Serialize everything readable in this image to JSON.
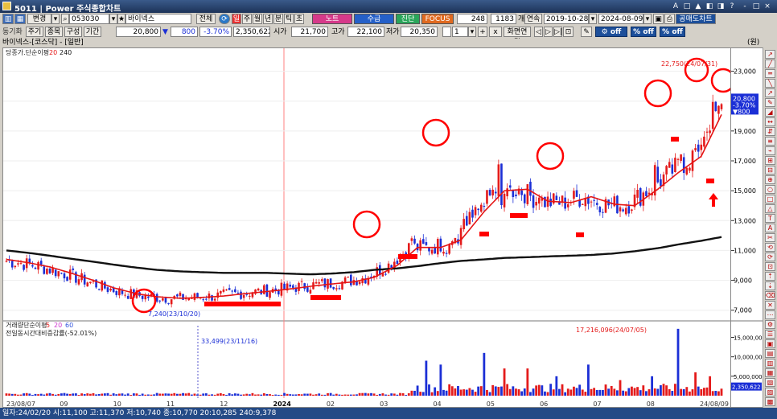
{
  "window": {
    "title": "5011 | Power 주식종합차트",
    "controls": [
      "A",
      "□",
      "▲",
      "◧",
      "◨",
      "?",
      "-",
      "□",
      "×"
    ]
  },
  "toolbar1": {
    "change_label": "변경",
    "code": "053030",
    "name": "바이넥스",
    "all_label": "전체",
    "periods": [
      "일",
      "주",
      "월",
      "년",
      "분",
      "틱",
      "초"
    ],
    "note_label": "노트",
    "supply_label": "수급",
    "diag_label": "진단",
    "focus_label": "FOCUS",
    "count1": "248",
    "count2": "1183",
    "count_unit": "개",
    "cont_label": "연속",
    "date_from": "2019-10-28",
    "date_to": "2024-08-09",
    "short_chart_label": "공매도차트"
  },
  "toolbar2": {
    "sync_label": "동기화",
    "tabs": [
      "주기",
      "종목",
      "구성",
      "기간"
    ],
    "price": "20,800",
    "arrow": "▼",
    "change": "800",
    "change_pct": "-3.70%",
    "volume": "2,350,622",
    "open_label": "시가",
    "open": "21,700",
    "high_label": "고가",
    "high": "22,100",
    "low_label": "저가",
    "low": "20,350",
    "screen_count": "1",
    "screen_label": "화면연결",
    "toggle1": "off",
    "toggle2": "off",
    "toggle3": "off"
  },
  "subheader": {
    "name": "바이넥스-[코스닥] - [일반]",
    "unit": "(원)"
  },
  "chart_data": [
    {
      "type": "candlestick",
      "title": "",
      "legend_text": "당종가.단순이평",
      "ma_periods": [
        "20",
        "240"
      ],
      "ylim": [
        6500,
        24000
      ],
      "y_ticks": [
        7000,
        9000,
        11000,
        13000,
        15000,
        17000,
        19000,
        21000,
        23000
      ],
      "y_tick_labels": [
        "7,000",
        "9,000",
        "11,000",
        "13,000",
        "15,000",
        "17,000",
        "19,000",
        "21,000",
        "23,000"
      ],
      "x_labels": [
        "23/08/07",
        "09",
        "10",
        "11",
        "12",
        "2024",
        "02",
        "03",
        "04",
        "05",
        "06",
        "07",
        "08",
        "24/08/09"
      ],
      "x_divider_label": "2024",
      "annotations": {
        "max": "22,750(24/07/31)",
        "min": "7,240(23/10/20)"
      },
      "current": {
        "price": "20,800",
        "change": "-3.70%",
        "delta": "▼800"
      },
      "ma20": [
        10400,
        10200,
        9900,
        9500,
        9000,
        8500,
        8100,
        7900,
        7800,
        7850,
        7950,
        8100,
        8250,
        8400,
        8600,
        8750,
        8900,
        9200,
        10000,
        11200,
        11200,
        11700,
        13600,
        15000,
        15100,
        14300,
        14200,
        14600,
        14100,
        14000,
        15100,
        16200,
        17300,
        20100
      ],
      "ma240": [
        11000,
        10850,
        10650,
        10450,
        10250,
        10050,
        9850,
        9700,
        9600,
        9550,
        9500,
        9500,
        9500,
        9450,
        9400,
        9450,
        9550,
        9700,
        9800,
        9950,
        10150,
        10300,
        10400,
        10500,
        10550,
        10600,
        10650,
        10700,
        10800,
        10950,
        11150,
        11400,
        11650,
        11900
      ]
    },
    {
      "type": "bar",
      "title": "",
      "legend_text": "거래량단순이평",
      "ma_periods": [
        "5",
        "20",
        "60"
      ],
      "subtitle": "전일동시간대비증감률(-52.01%)",
      "ylim": [
        0,
        18000000
      ],
      "y_ticks": [
        5000000,
        10000000,
        15000000
      ],
      "y_tick_labels": [
        "5,000,000",
        "10,000,000",
        "15,000,000"
      ],
      "annotations": {
        "max": "17,216,096(24/07/05)",
        "min": "33,499(23/11/16)"
      },
      "current": "2,350,622"
    }
  ],
  "toolstrip": {
    "buttons": [
      "↗",
      "╱",
      "═",
      "╲",
      "↗",
      "✎",
      "◢",
      "↔",
      "⇵",
      "≡",
      "⌁",
      "⊞",
      "⊟",
      "⊕",
      "○",
      "□",
      "△",
      "T",
      "A",
      "✂",
      "⟲",
      "⟳",
      "⊡",
      "⇡",
      "⇣",
      "⌫",
      "✕",
      "⋯",
      "⚙",
      "☰",
      "▣",
      "▤",
      "▥",
      "▦",
      "▧",
      "▨",
      "▩"
    ]
  },
  "statusbar": {
    "text": "일자:24/02/20 시:11,100 고:11,370 저:10,740 종:10,770 20:10,285 240:9,378"
  },
  "colors": {
    "up": "#e41b1b",
    "down": "#1b2fd6",
    "ma20": "#e51515",
    "ma240": "#111111",
    "highlight": "#ff0000"
  }
}
